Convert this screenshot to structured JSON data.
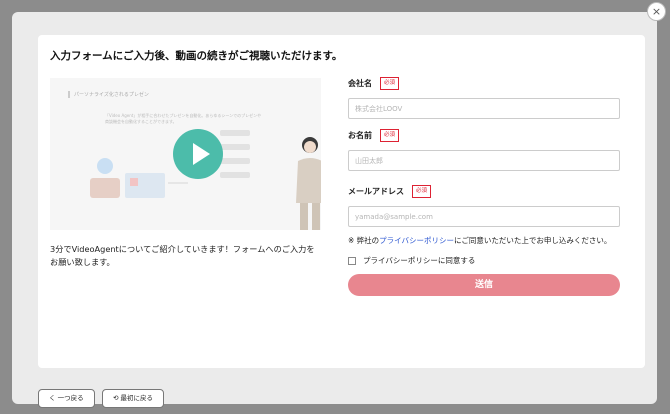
{
  "modal": {
    "heading": "入力フォームにご入力後、動画の続きがご視聴いただけます。",
    "close_glyph": "×"
  },
  "video": {
    "overlay_label": "パーソナライズ化されるプレゼン",
    "overlay_text": "「Video Agent」が相手に合わせたプレゼンを自動化。あらゆるシーンでのプレゼンや商談機会を自動化することができます。",
    "description": "3分でVideoAgentについてご紹介していきます！フォームへのご入力をお願い致します。"
  },
  "form": {
    "required_badge": "必須",
    "company": {
      "label": "会社名",
      "placeholder": "株式会社LOOV",
      "value": ""
    },
    "name": {
      "label": "お名前",
      "placeholder": "山田太郎",
      "value": ""
    },
    "email": {
      "label": "メールアドレス",
      "placeholder": "yamada@sample.com",
      "value": ""
    },
    "notice_prefix": "※ 弊社の",
    "notice_link": "プライバシーポリシー",
    "notice_suffix": "にご同意いただいた上でお申し込みください。",
    "agree_label": "プライバシーポリシーに同意する",
    "agree_checked": false,
    "submit_label": "送信"
  },
  "footer": {
    "back_label": "く 一つ戻る",
    "restart_label": "⟲ 最初に戻る"
  },
  "colors": {
    "accent_play": "#4cbcaa",
    "submit_bg": "#e8868f",
    "required": "#dd2233",
    "link": "#2a55d0"
  }
}
